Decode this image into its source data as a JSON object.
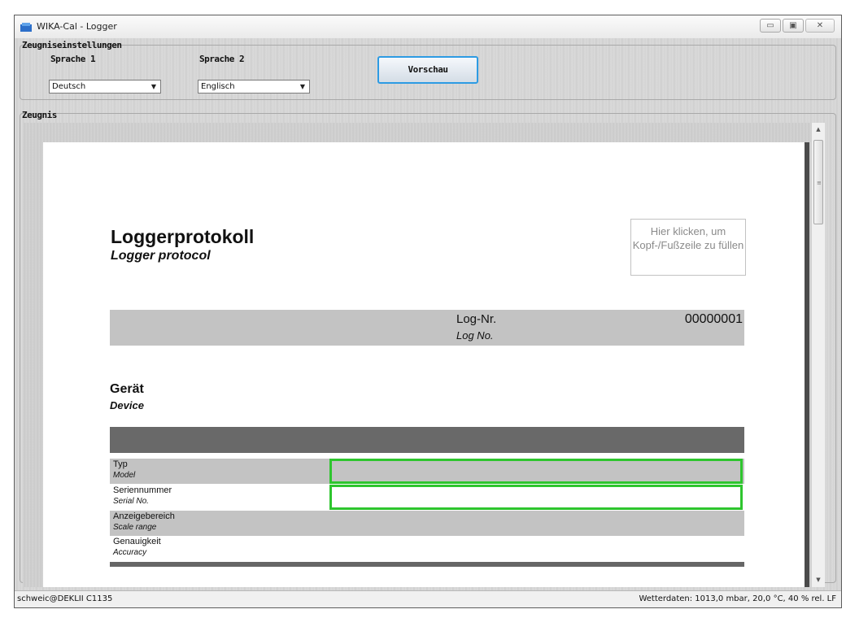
{
  "window": {
    "title": "WIKA-Cal - Logger",
    "controls": [
      "minimize",
      "maximize",
      "close"
    ]
  },
  "settings": {
    "group_title": "Zeugniseinstellungen",
    "language1_label": "Sprache 1",
    "language1_value": "Deutsch",
    "language2_label": "Sprache 2",
    "language2_value": "Englisch",
    "preview_button": "Vorschau"
  },
  "certificate": {
    "group_title": "Zeugnis"
  },
  "document": {
    "title": "Loggerprotokoll",
    "subtitle": "Logger protocol",
    "header_placeholder": "Hier klicken, um Kopf-/Fußzeile zu füllen",
    "log_number_label": "Log-Nr.",
    "log_number_label_en": "Log No.",
    "log_number_value": "00000001",
    "device_title": "Gerät",
    "device_subtitle": "Device",
    "rows": [
      {
        "label": "Typ",
        "label_en": "Model"
      },
      {
        "label": "Seriennummer",
        "label_en": "Serial No."
      },
      {
        "label": "Anzeigebereich",
        "label_en": "Scale range"
      },
      {
        "label": "Genauigkeit",
        "label_en": "Accuracy"
      }
    ],
    "highlight_color": "#2ec52e"
  },
  "status": {
    "user": "schweic@DEKLII C1135",
    "weather": "Wetterdaten: 1013,0 mbar, 20,0 °C, 40 % rel. LF"
  }
}
